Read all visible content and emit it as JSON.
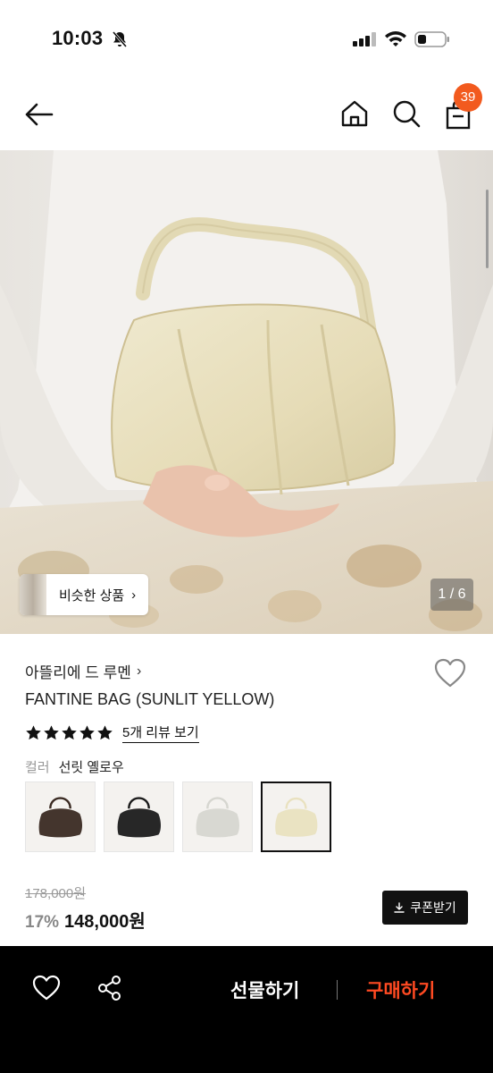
{
  "status_bar": {
    "time": "10:03"
  },
  "header": {
    "cart_count": "39"
  },
  "hero": {
    "similar_label": "비슷한 상품",
    "similar_chevron": "›",
    "page_indicator": "1 / 6"
  },
  "product": {
    "brand": "아뜰리에 드 루멘",
    "brand_chevron": "›",
    "name": "FANTINE BAG (SUNLIT YELLOW)",
    "rating": 5,
    "review_link": "5개 리뷰 보기",
    "color_label": "컬러",
    "color_value": "선릿 옐로우",
    "swatches": [
      {
        "name": "dark-brown",
        "color": "#3a2a22"
      },
      {
        "name": "black",
        "color": "#1b1b1b"
      },
      {
        "name": "silver",
        "color": "#d6d6d0"
      },
      {
        "name": "sunlit-yellow",
        "color": "#e9e1bf"
      }
    ],
    "selected_swatch": 3,
    "original_price": "178,000원",
    "discount": "17%",
    "sale_price": "148,000원",
    "coupon_label": "쿠폰받기"
  },
  "bottom_bar": {
    "gift_label": "선물하기",
    "buy_label": "구매하기"
  },
  "colors": {
    "badge": "#f25a1e",
    "buy": "#ff4a22"
  }
}
